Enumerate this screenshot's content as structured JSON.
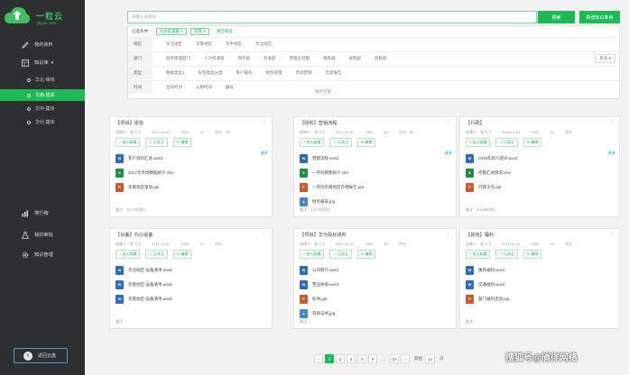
{
  "brand": {
    "title": "一粒云",
    "subtitle": "yliyun.com"
  },
  "sidebar": {
    "items": [
      {
        "label": "我的资料",
        "icon": "pen-icon"
      },
      {
        "label": "知识库",
        "icon": "library-icon",
        "chevron": "▾"
      }
    ],
    "sub_items": [
      {
        "label": "华北-审核"
      },
      {
        "label": "华南-集体"
      },
      {
        "label": "华中-集体"
      },
      {
        "label": "华北-集体"
      }
    ],
    "bottom_items": [
      {
        "label": "排行榜",
        "icon": "bar-chart-icon"
      },
      {
        "label": "我的审批",
        "icon": "flask-icon"
      },
      {
        "label": "知识管理",
        "icon": "gear-icon"
      }
    ],
    "back_label": "返回云盘"
  },
  "search": {
    "placeholder": "请输入关键词",
    "button": "搜索",
    "new_button": "新增知识条目"
  },
  "filters": {
    "crumb_label": "已选条件：",
    "tags": [
      "人力资源部 ×",
      "华南 ×"
    ],
    "reset": "清空筛选",
    "rows": [
      {
        "label": "地区",
        "options": [
          "华北地区",
          "华南地区",
          "华中地区",
          "华北地区"
        ]
      },
      {
        "label": "部门",
        "options": [
          "财务管理部门",
          "人力资源部",
          "财务部",
          "开发部",
          "营销企划部",
          "销售部",
          "采购部",
          "后勤部"
        ],
        "more": "更多 ▾"
      },
      {
        "label": "类型",
        "options": [
          "数据类型1",
          "标签类型分类",
          "客户服务",
          "财务管理",
          "市场营销",
          "年度报告"
        ]
      },
      {
        "label": "时间",
        "options": [
          "合同时间",
          "入职时间",
          "编号"
        ]
      }
    ],
    "expand": "展开全部 ⌄"
  },
  "cards": [
    {
      "title": "【项目】报告",
      "menu": "⋮",
      "meta": [
        "创建人：张飞飞",
        "2017-01-01",
        "1000",
        "12",
        "评分：78"
      ],
      "actions": [
        "+ 加入收藏",
        "✓ 已关注",
        "↻ 编辑"
      ],
      "more": "更多",
      "files": [
        {
          "type": "word",
          "name": "客户资料汇总.word"
        },
        {
          "type": "xls",
          "name": "2017年市场数据统计.xlsx"
        },
        {
          "type": "ppt",
          "name": "华南地区策划.ppt"
        }
      ],
      "note": "备注：2017年资料"
    },
    {
      "title": "【财务】营销流程",
      "menu": "⋮",
      "meta": [
        "创建人：张飞飞",
        "2017-01-01",
        "1000",
        "12",
        "评分：90"
      ],
      "actions": [
        "+ 加入收藏",
        "✓ 已关注",
        "↻ 编辑"
      ],
      "more": "更多",
      "files": [
        {
          "type": "word",
          "name": "营销流程.word"
        },
        {
          "type": "xls",
          "name": "一月份销售统计.xlsx"
        },
        {
          "type": "ppt",
          "name": "一月份华南地区开销报告.ppt"
        },
        {
          "type": "img",
          "name": "财务报表.jpg"
        }
      ],
      "note": "备注：2017年资料"
    },
    {
      "title": "【行政】",
      "menu": "⋮",
      "meta": [
        "创建人：张飞飞",
        "2018-01-01",
        "1000",
        "12",
        "评分"
      ],
      "actions": [
        "+ 加入收藏",
        "✓ 已关注",
        "↻ 编辑"
      ],
      "more": "更多",
      "files": [
        {
          "type": "word",
          "name": "2018年新人培训.word"
        },
        {
          "type": "xls",
          "name": "考勤汇总情况.xlsx"
        },
        {
          "type": "ppt",
          "name": "行政工作.ppt"
        }
      ],
      "note": "备注：2018年资料"
    },
    {
      "title": "【设备】办公设备",
      "menu": "⋮",
      "meta": [
        "创建人：张飞飞",
        "2017-01-01",
        "1000",
        "12",
        "评分"
      ],
      "actions": [
        "+ 加入收藏",
        "✓ 已关注",
        "↻ 编辑"
      ],
      "more": "",
      "files": [
        {
          "type": "word",
          "name": "华北地区-设备清单.word"
        },
        {
          "type": "word",
          "name": "华南地区-设备清单.word"
        },
        {
          "type": "word",
          "name": "华南地区-设备清单.word"
        }
      ],
      "note": "备注："
    },
    {
      "title": "【项目】华为投标资料",
      "menu": "⋮",
      "meta": [
        "创建人：张飞飞",
        "2017-01-01",
        "1000",
        "12",
        "评分"
      ],
      "actions": [
        "+ 加入收藏",
        "✓ 已关注",
        "↻ 编辑"
      ],
      "more": "",
      "files": [
        {
          "type": "word",
          "name": "公司简介.word"
        },
        {
          "type": "word",
          "name": "营业执照.word"
        },
        {
          "type": "ppt",
          "name": "标书.ppt"
        },
        {
          "type": "img",
          "name": "资质证书.jpg"
        }
      ],
      "note": "备注："
    },
    {
      "title": "【其他】福利",
      "menu": "⋮",
      "meta": [
        "创建人：张飞飞",
        "2017-01-01",
        "1000",
        "12",
        "评分"
      ],
      "actions": [
        "+ 加入收藏",
        "✓ 已关注",
        "↻ 编辑"
      ],
      "more": "",
      "files": [
        {
          "type": "word",
          "name": "重阳福利.word"
        },
        {
          "type": "word",
          "name": "交通福利.word"
        },
        {
          "type": "ppt",
          "name": "部门福利活动.ppt"
        }
      ],
      "note": "备注："
    }
  ],
  "pager": {
    "prev": "‹",
    "pages": [
      "1",
      "2",
      "3",
      "4",
      "5",
      "...",
      "10"
    ],
    "next": "›",
    "goto": "前往",
    "current": "10",
    "unit": "页"
  },
  "watermark": "搜狐号@徜徉网络",
  "colors": {
    "accent": "#1db954",
    "sidebar": "#2e2f30",
    "link": "#2a8fd6"
  }
}
